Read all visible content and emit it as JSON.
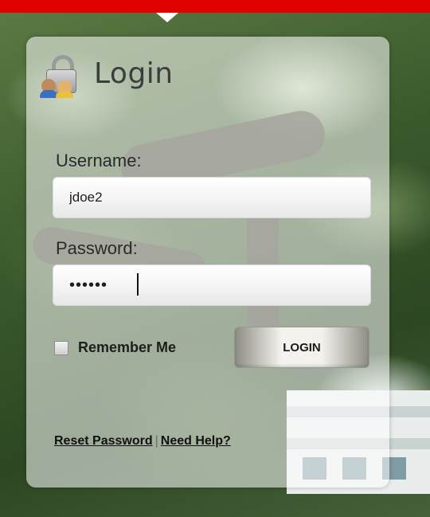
{
  "login": {
    "title": "Login",
    "username_label": "Username:",
    "username_value": "jdoe2",
    "password_label": "Password:",
    "password_value": "••••••",
    "remember_label": "Remember Me",
    "remember_checked": false,
    "login_button": "LOGIN",
    "reset_password_link": "Reset Password",
    "separator": "|",
    "help_link": "Need Help?"
  },
  "colors": {
    "top_bar": "#e10000",
    "panel": "rgba(255,255,255,0.55)"
  },
  "icons": {
    "title_icon": "lock-users-icon"
  }
}
